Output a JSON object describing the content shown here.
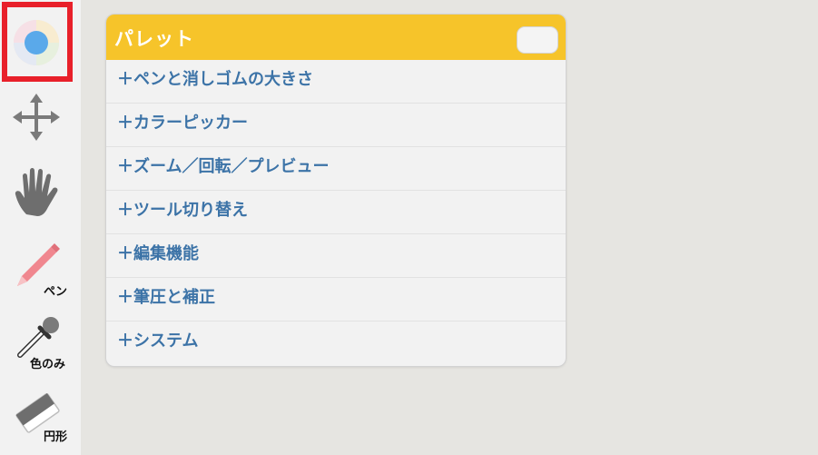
{
  "toolbar": {
    "tools": [
      {
        "name": "color-picker-tool",
        "icon": "color-wheel-icon",
        "label": ""
      },
      {
        "name": "move-tool",
        "icon": "move-arrows-icon",
        "label": ""
      },
      {
        "name": "hand-tool",
        "icon": "hand-icon",
        "label": ""
      },
      {
        "name": "pen-tool",
        "icon": "pencil-icon",
        "label": "ペン"
      },
      {
        "name": "eyedropper-tool",
        "icon": "eyedropper-icon",
        "label": "色のみ"
      },
      {
        "name": "eraser-tool",
        "icon": "eraser-icon",
        "label": "円形"
      }
    ],
    "highlight_color": "#e8202a"
  },
  "palette": {
    "title": "パレット",
    "header_color": "#f6c42a",
    "sections": [
      "＋ペンと消しゴムの大きさ",
      "＋カラーピッカー",
      "＋ズーム／回転／プレビュー",
      "＋ツール切り替え",
      "＋編集機能",
      "＋筆圧と補正",
      "＋システム"
    ]
  }
}
